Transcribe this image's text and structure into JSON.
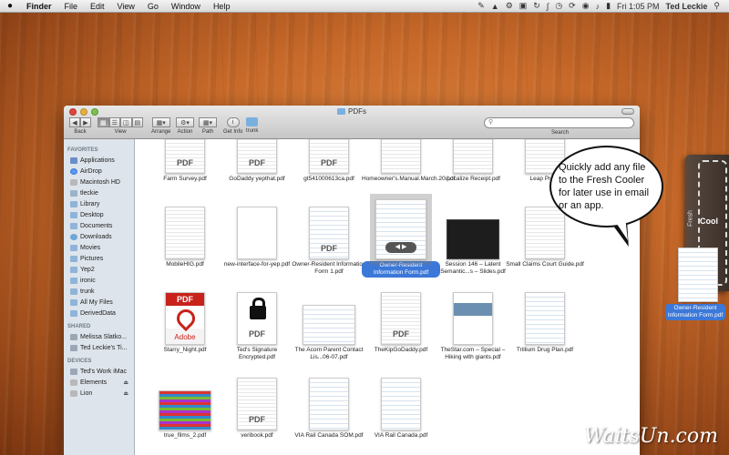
{
  "menubar": {
    "apple": "",
    "items": [
      "Finder",
      "File",
      "Edit",
      "View",
      "Go",
      "Window",
      "Help"
    ],
    "clock": "Fri 1:05 PM",
    "user": "Ted Leckie"
  },
  "window": {
    "title": "PDFs",
    "toolbar": {
      "back_label": "Back",
      "view_label": "View",
      "arrange_label": "Arrange",
      "action_label": "Action",
      "path_label": "Path",
      "getinfo_label": "Get Info",
      "trunk_label": "trunk",
      "search_label": "Search",
      "search_placeholder": ""
    },
    "sidebar": {
      "favorites_header": "FAVORITES",
      "favorites": [
        "Applications",
        "AirDrop",
        "Macintosh HD",
        "tleckie",
        "Library",
        "Desktop",
        "Documents",
        "Downloads",
        "Movies",
        "Pictures",
        "Yep2",
        "ironic",
        "trunk",
        "All My Files",
        "DerivedData"
      ],
      "shared_header": "SHARED",
      "shared": [
        "Melissa Slatko...",
        "Ted Leckie's Ti..."
      ],
      "devices_header": "DEVICES",
      "devices": [
        "Ted's Work iMac",
        "Elements",
        "Lion"
      ]
    },
    "files": [
      {
        "name": "Farm Survey.pdf"
      },
      {
        "name": "GoDaddy yepthat.pdf"
      },
      {
        "name": "gt541000613ca.pdf"
      },
      {
        "name": "Homeowner's.Manual.March.20.pdf"
      },
      {
        "name": "iLocalize Receipt.pdf"
      },
      {
        "name": "Leap Press"
      },
      {
        "name": "MobileHIG.pdf"
      },
      {
        "name": "new-interface-for-yep.pdf"
      },
      {
        "name": "Owner-Resident Information Form 1.pdf"
      },
      {
        "name": "Owner-Resident Information Form.pdf"
      },
      {
        "name": "Session 146 – Latent Semantic...s – Slides.pdf"
      },
      {
        "name": "Small Claims Court Guide.pdf"
      },
      {
        "name": "Starry_Night.pdf"
      },
      {
        "name": "Ted's Signature Encrypted.pdf"
      },
      {
        "name": "The Acorn Parent Contact Lis...06-07.pdf"
      },
      {
        "name": "TheKipGoDaddy.pdf"
      },
      {
        "name": "TheStar.com – Special – Hiking with giants.pdf"
      },
      {
        "name": "Trillium Drug Plan.pdf"
      },
      {
        "name": "true_films_2.pdf"
      },
      {
        "name": "veribook.pdf"
      },
      {
        "name": "VIA Rail Canada SOM.pdf"
      },
      {
        "name": "VIA Rail Canada.pdf"
      }
    ],
    "pdf_tag": "PDF",
    "adobe_tag": "PDF",
    "adobe_word": "Adobe"
  },
  "callout": {
    "text": "Quickly add any file to the Fresh Cooler for later use in email or an app."
  },
  "cooler": {
    "tab": "Fresh",
    "title": "Cool",
    "dragged_file": "Owner-Resident Information Form.pdf"
  },
  "watermark": "WaitsUn.com",
  "colors": {
    "selection": "#3b78d8",
    "desktop": "#c86a2a"
  }
}
